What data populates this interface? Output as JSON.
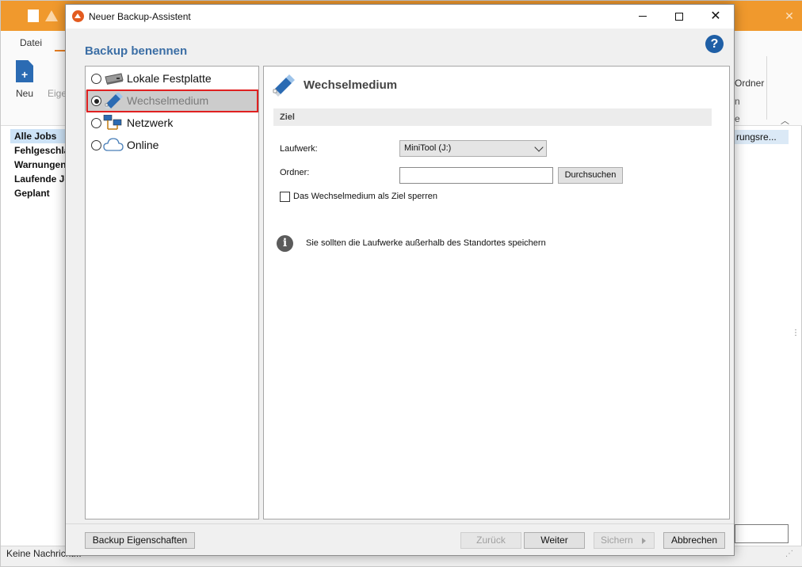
{
  "background_app": {
    "ribbon_tab_file": "Datei",
    "ribbon_new_label": "Neu",
    "ribbon_eig_label": "Eige",
    "ribbon_ordner_label": "Ordner",
    "ribbon_frag1": "n",
    "ribbon_frag2": "e",
    "nav_items": [
      "Alle Jobs",
      "Fehlgeschla",
      "Warnungen",
      "Laufende Jo",
      "Geplant"
    ],
    "column_header": "rungsre...",
    "status_text": "Keine Nachricht..."
  },
  "dialog": {
    "title": "Neuer Backup-Assistent",
    "heading": "Backup benennen",
    "help_symbol": "?",
    "destinations": [
      {
        "label": "Lokale Festplatte",
        "icon": "hard-drive-icon",
        "checked": false
      },
      {
        "label": "Wechselmedium",
        "icon": "usb-drive-icon",
        "checked": true
      },
      {
        "label": "Netzwerk",
        "icon": "network-icon",
        "checked": false
      },
      {
        "label": "Online",
        "icon": "cloud-icon",
        "checked": false
      }
    ],
    "panel": {
      "title": "Wechselmedium",
      "section": "Ziel",
      "drive_label": "Laufwerk:",
      "drive_value": "MiniTool (J:)",
      "folder_label": "Ordner:",
      "folder_value": "",
      "browse_label": "Durchsuchen",
      "lock_checkbox_label": "Das Wechselmedium als Ziel sperren",
      "lock_checked": false,
      "info_symbol": "i",
      "info_text": "Sie sollten die Laufwerke außerhalb des Standortes speichern"
    },
    "footer": {
      "properties_label": "Backup Eigenschaften",
      "back_label": "Zurück",
      "next_label": "Weiter",
      "save_label": "Sichern",
      "cancel_label": "Abbrechen"
    }
  },
  "colors": {
    "app_accent": "#f0992d",
    "heading_blue": "#3b6ea5",
    "selection_outline": "#e02020"
  }
}
